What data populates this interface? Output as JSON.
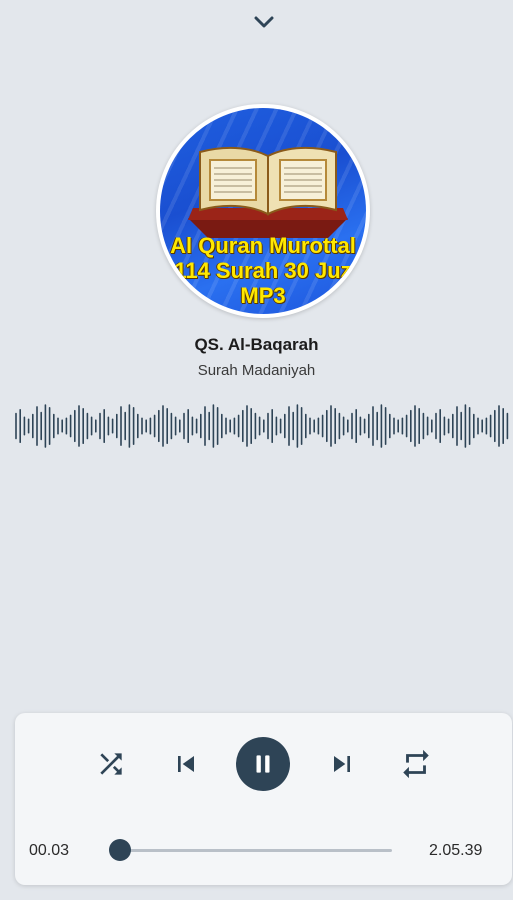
{
  "header": {
    "collapse_icon": "chevron-down-icon"
  },
  "album": {
    "cover_lines": [
      "Al Quran Murottal",
      "114 Surah 30 Juz",
      "MP3"
    ],
    "brand_color": "#1f5fe0",
    "text_color": "#ffe800"
  },
  "track": {
    "title": "QS. Al-Baqarah",
    "subtitle": "Surah Madaniyah"
  },
  "player": {
    "controls": {
      "shuffle_icon": "shuffle-icon",
      "previous_icon": "skip-previous-icon",
      "pause_icon": "pause-icon",
      "next_icon": "skip-next-icon",
      "repeat_icon": "repeat-icon"
    },
    "elapsed": "00.03",
    "duration": "2.05.39",
    "progress_fraction": 0.0,
    "accent_color": "#2e4456"
  }
}
